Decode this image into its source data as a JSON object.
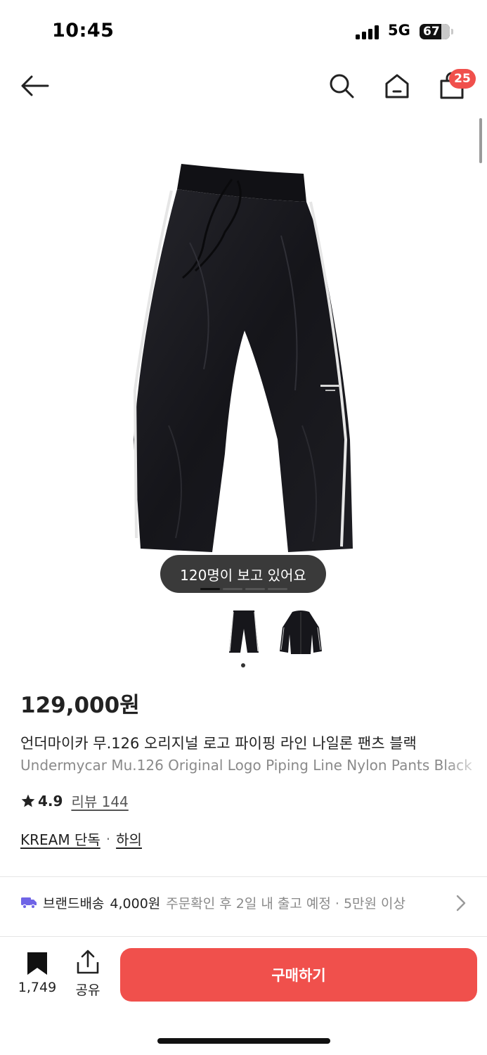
{
  "status_bar": {
    "time": "10:45",
    "network": "5G",
    "battery": "67",
    "battery_level": 0.67
  },
  "nav": {
    "cart_count": "25"
  },
  "product": {
    "viewers_text": "120명이 보고 있어요",
    "image_count": 4,
    "active_image": 1,
    "price": "129,000원",
    "name_ko": "언더마이카 무.126 오리지널 로고 파이핑 라인 나일론 팬츠 블랙",
    "name_en": "Undermycar Mu.126 Original Logo Piping Line Nylon Pants Black",
    "rating": "4.9",
    "reviews": "리뷰 144",
    "tags": [
      "KREAM 단독",
      "하의"
    ],
    "tag_separator": "·"
  },
  "shipping": {
    "title": "브랜드배송",
    "fee": "4,000원",
    "detail": "주문확인 후 2일 내 출고 예정 · 5만원 이상"
  },
  "bottom": {
    "bookmark_count": "1,749",
    "share_label": "공유",
    "buy_label": "구매하기"
  },
  "colors": {
    "accent": "#f0504c",
    "pill_bg": "#3a3a3a",
    "product": "#1b1b1f"
  }
}
